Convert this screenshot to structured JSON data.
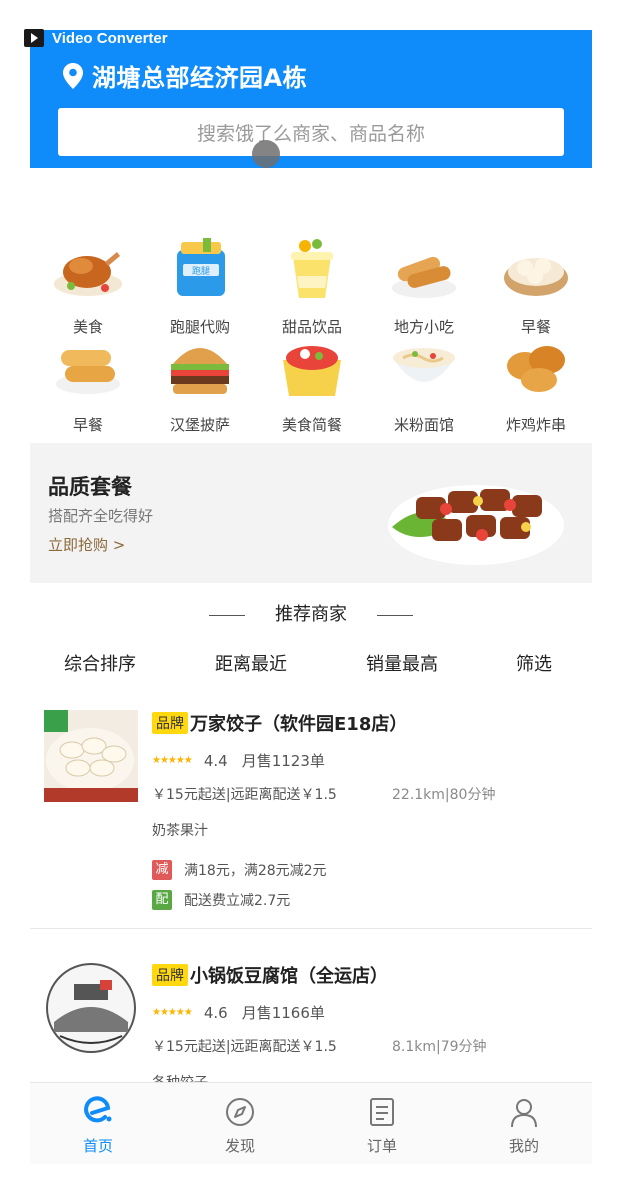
{
  "recorder": {
    "label": "Video Converter"
  },
  "header": {
    "location": "湖塘总部经济园A栋",
    "search_placeholder": "搜索饿了么商家、商品名称"
  },
  "categories": [
    {
      "label": "美食",
      "icon": "roast-chicken-icon"
    },
    {
      "label": "跑腿代购",
      "icon": "errand-bag-icon"
    },
    {
      "label": "甜品饮品",
      "icon": "dessert-cup-icon"
    },
    {
      "label": "地方小吃",
      "icon": "spring-roll-icon"
    },
    {
      "label": "早餐",
      "icon": "dumpling-steamer-icon"
    },
    {
      "label": "早餐",
      "icon": "bread-roll-icon"
    },
    {
      "label": "汉堡披萨",
      "icon": "burger-icon"
    },
    {
      "label": "美食简餐",
      "icon": "bento-box-icon"
    },
    {
      "label": "米粉面馆",
      "icon": "noodle-bowl-icon"
    },
    {
      "label": "炸鸡炸串",
      "icon": "fried-chicken-icon"
    }
  ],
  "banner": {
    "title": "品质套餐",
    "subtitle": "搭配齐全吃得好",
    "cta": "立即抢购 >"
  },
  "recommend": {
    "title": "推荐商家"
  },
  "sorts": [
    "综合排序",
    "距离最近",
    "销量最高",
    "筛选"
  ],
  "shops": [
    {
      "brand": "品牌",
      "name": "万家饺子（软件园E18店）",
      "stars": "★★★★★",
      "rating": "4.4",
      "sales": "月售1123单",
      "delivery": "￥15元起送|远距离配送￥1.5",
      "distance": "22.1km|80分钟",
      "category": "奶茶果汁",
      "promos": [
        {
          "badge": "减",
          "text": "满18元，满28元减2元",
          "color": "#e05a5a"
        },
        {
          "badge": "配",
          "text": "配送费立减2.7元",
          "color": "#5aa844"
        }
      ]
    },
    {
      "brand": "品牌",
      "name": "小锅饭豆腐馆（全运店）",
      "stars": "★★★★★",
      "rating": "4.6",
      "sales": "月售1166单",
      "delivery": "￥15元起送|远距离配送￥1.5",
      "distance": "8.1km|79分钟",
      "category": "各种饺子"
    }
  ],
  "tabs": [
    {
      "label": "首页",
      "icon": "eleme-home-icon",
      "active": true
    },
    {
      "label": "发现",
      "icon": "compass-icon"
    },
    {
      "label": "订单",
      "icon": "order-list-icon"
    },
    {
      "label": "我的",
      "icon": "user-icon"
    }
  ],
  "colors": {
    "brand_blue": "#0f8cfa",
    "brand_tag": "#ffd80f",
    "star": "#ffb400"
  }
}
